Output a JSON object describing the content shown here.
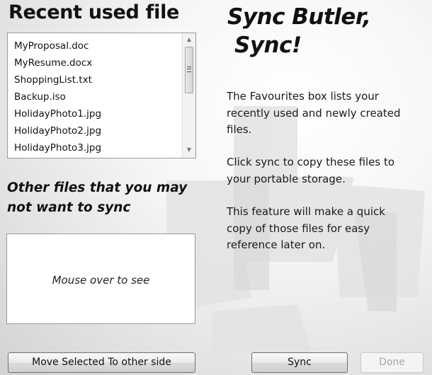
{
  "left_panel": {
    "recent_title": "Recent used file",
    "recent_files": [
      "MyProposal.doc",
      "MyResume.docx",
      "ShoppingList.txt",
      "Backup.iso",
      "HolidayPhoto1.jpg",
      "HolidayPhoto2.jpg",
      "HolidayPhoto3.jpg"
    ],
    "other_title_line1": "Other files that you may",
    "other_title_line2": "not want to sync",
    "other_box_hint": "Mouse over to see"
  },
  "right_panel": {
    "title_line1": "Sync Butler,",
    "title_line2": "Sync!",
    "description": [
      [
        "The Favourites box lists your",
        "recently used and newly created",
        "files."
      ],
      [
        "Click sync to copy these files to",
        "your portable storage."
      ],
      [
        "This feature will make a quick",
        "copy of those files for easy",
        "reference later on."
      ]
    ]
  },
  "buttons": {
    "move_label": "Move Selected To other side",
    "sync_label": "Sync",
    "done_label": "Done"
  }
}
